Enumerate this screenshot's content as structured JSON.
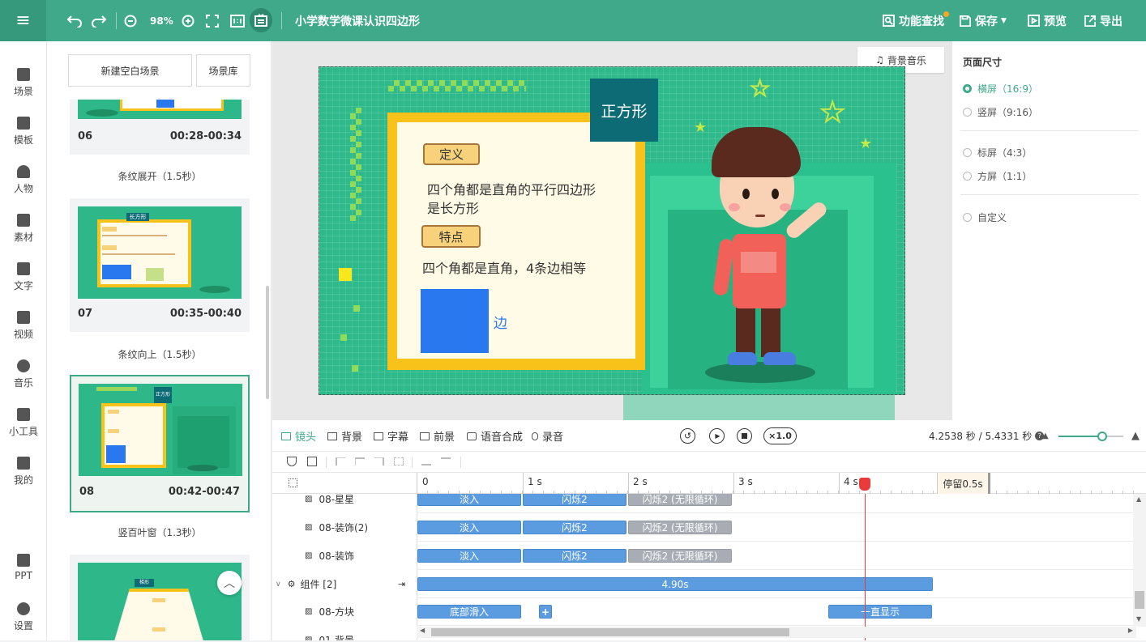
{
  "topbar": {
    "zoom": "98%",
    "title": "小学数学微课认识四边形",
    "find_label": "功能查找",
    "save_label": "保存",
    "preview_label": "预览",
    "export_label": "导出"
  },
  "sidebar": {
    "items": [
      {
        "label": "场景"
      },
      {
        "label": "模板"
      },
      {
        "label": "人物"
      },
      {
        "label": "素材"
      },
      {
        "label": "文字"
      },
      {
        "label": "视频"
      },
      {
        "label": "音乐"
      },
      {
        "label": "小工具"
      },
      {
        "label": "我的"
      },
      {
        "label": "PPT"
      },
      {
        "label": "设置"
      }
    ]
  },
  "scenes": {
    "new_blank": "新建空白场景",
    "library": "场景库",
    "cards": [
      {
        "num": "06",
        "time": "00:28-00:34",
        "transition": "条纹展开（1.5秒）"
      },
      {
        "num": "07",
        "time": "00:35-00:40",
        "transition": "条纹向上（1.5秒）",
        "thumb_title": "长方形"
      },
      {
        "num": "08",
        "time": "00:42-00:47",
        "transition": "竖百叶窗（1.3秒）",
        "thumb_title": "正方形"
      },
      {
        "num": "",
        "time": "",
        "transition": "",
        "thumb_title": "梯形"
      }
    ]
  },
  "canvas": {
    "bg_music": "背景音乐",
    "slide_title": "正方形",
    "tag_definition": "定义",
    "definition_line1": "四个角都是直角的平行四边形",
    "definition_line2": "是长方形",
    "tag_feature": "特点",
    "feature_text": "四个角都是直角，4条边相等",
    "side_label": "边"
  },
  "page_size": {
    "title": "页面尺寸",
    "options": [
      {
        "label": "横屏（16:9）",
        "selected": true
      },
      {
        "label": "竖屏（9:16）",
        "selected": false
      },
      {
        "label": "标屏（4:3）",
        "selected": false
      },
      {
        "label": "方屏（1:1）",
        "selected": false
      },
      {
        "label": "自定义",
        "selected": false
      }
    ]
  },
  "timeline": {
    "tabs": [
      {
        "label": "镜头",
        "active": true
      },
      {
        "label": "背景"
      },
      {
        "label": "字幕"
      },
      {
        "label": "前景"
      },
      {
        "label": "语音合成"
      },
      {
        "label": "录音"
      }
    ],
    "speed": "×1.0",
    "time_readout": "4.2538 秒 / 5.4331 秒",
    "ruler": [
      "0",
      "1 s",
      "2 s",
      "3 s",
      "4 s"
    ],
    "pause_label": "停留0.5s",
    "tracks": [
      {
        "name": "08-星星",
        "clips": [
          "淡入",
          "闪烁2",
          "闪烁2 (无限循环)"
        ]
      },
      {
        "name": "08-装饰(2)",
        "clips": [
          "淡入",
          "闪烁2",
          "闪烁2 (无限循环)"
        ]
      },
      {
        "name": "08-装饰",
        "clips": [
          "淡入",
          "闪烁2",
          "闪烁2 (无限循环)"
        ]
      },
      {
        "name": "组件 [2]",
        "clips": [
          "4.90s"
        ]
      },
      {
        "name": "08-方块",
        "clips": [
          "底部滑入",
          "一直显示"
        ]
      },
      {
        "name": "01-背景",
        "clips": []
      }
    ]
  },
  "colors": {
    "accent": "#3fa98a",
    "clip_blue": "#5b9bdf",
    "slide_green": "#2db98a",
    "frame_yellow": "#f8c21a"
  }
}
